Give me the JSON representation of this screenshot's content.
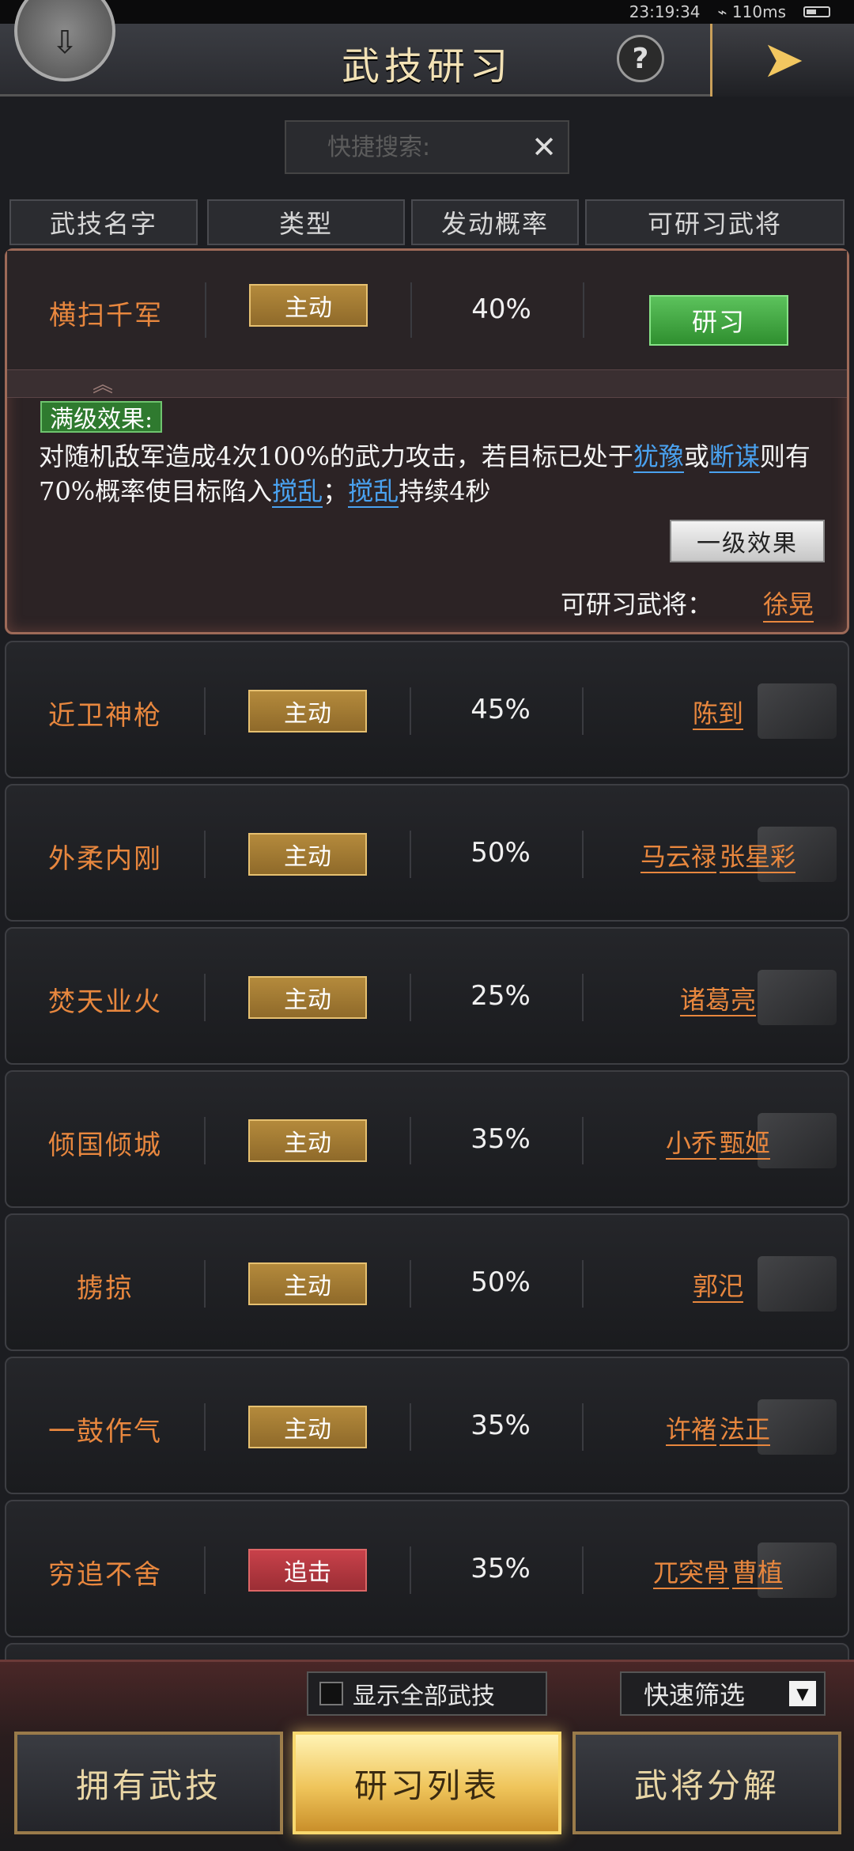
{
  "status_bar": {
    "time": "23:19:34",
    "latency": "110ms"
  },
  "header": {
    "title": "武技研习",
    "help": "?",
    "arrow": "➤",
    "back": "⇩"
  },
  "search": {
    "placeholder": "快捷搜索:",
    "clear": "✕"
  },
  "columns": [
    "武技名字",
    "类型",
    "发动概率",
    "可研习武将"
  ],
  "expanded": {
    "name": "横扫千军",
    "type": "主动",
    "rate": "40%",
    "action": "研习",
    "collapse": "︽",
    "max_label": "满级效果:",
    "effect": {
      "p1": "对随机敌军造成4次100%的武力攻击，若目标已处于",
      "k1": "犹豫",
      "p2": "或",
      "k2": "断谋",
      "p3": "则有70%概率使目标陷入",
      "k3": "搅乱",
      "p4": "；",
      "k4": "搅乱",
      "p5": "持续4秒"
    },
    "level1_button": "一级效果",
    "general_label": "可研习武将：",
    "general": "徐晃"
  },
  "rows": [
    {
      "name": "近卫神枪",
      "type": "主动",
      "rate": "45%",
      "g1": "陈到",
      "g2": ""
    },
    {
      "name": "外柔内刚",
      "type": "主动",
      "rate": "50%",
      "g1": "马云禄",
      "g2": "张星彩"
    },
    {
      "name": "焚天业火",
      "type": "主动",
      "rate": "25%",
      "g1": "诸葛亮",
      "g2": ""
    },
    {
      "name": "倾国倾城",
      "type": "主动",
      "rate": "35%",
      "g1": "小乔",
      "g2": "甄姬"
    },
    {
      "name": "掳掠",
      "type": "主动",
      "rate": "50%",
      "g1": "郭汜",
      "g2": ""
    },
    {
      "name": "一鼓作气",
      "type": "主动",
      "rate": "35%",
      "g1": "许褚",
      "g2": "法正"
    },
    {
      "name": "穷追不舍",
      "type": "追击",
      "rate": "35%",
      "g1": "兀突骨",
      "g2": "曹植"
    }
  ],
  "bottom": {
    "show_all": "显示全部武技",
    "quick_filter": "快速筛选",
    "dropdown": "▼",
    "tabs": [
      "拥有武技",
      "研习列表",
      "武将分解"
    ]
  },
  "colors": {
    "accent_orange": "#e8873e",
    "active_type": "#b48a3c",
    "chase_type": "#c8414a",
    "study_green": "#3fa83f",
    "keyword_blue": "#4aa2f0"
  }
}
